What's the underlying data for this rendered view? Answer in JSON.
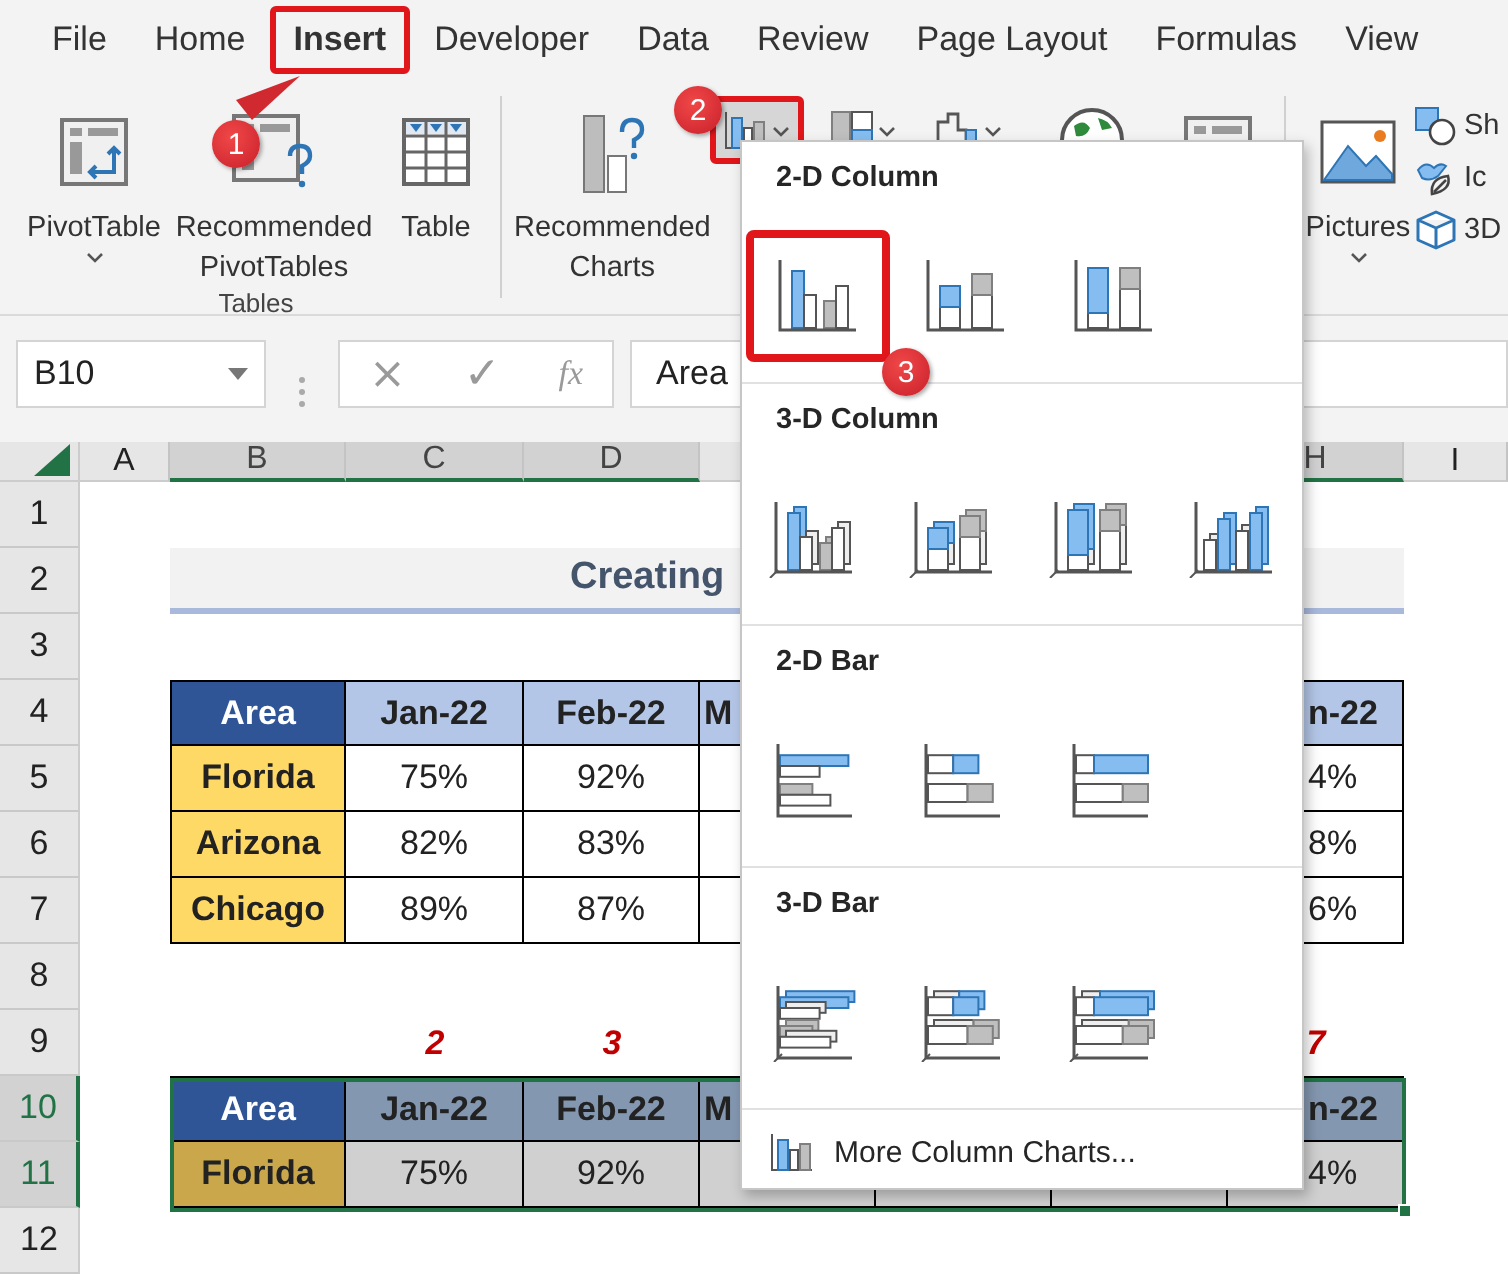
{
  "menu_tabs": [
    {
      "label": "File",
      "selected": false
    },
    {
      "label": "Home",
      "selected": false
    },
    {
      "label": "Insert",
      "selected": true
    },
    {
      "label": "Developer",
      "selected": false
    },
    {
      "label": "Data",
      "selected": false
    },
    {
      "label": "Review",
      "selected": false
    },
    {
      "label": "Page Layout",
      "selected": false
    },
    {
      "label": "Formulas",
      "selected": false
    },
    {
      "label": "View",
      "selected": false
    }
  ],
  "ribbon": {
    "groups": [
      {
        "label": "Tables",
        "buttons": [
          {
            "kind": "pivot-table",
            "label": "PivotTable",
            "dropdown": true
          },
          {
            "kind": "recommended-pivot",
            "label": "Recommended PivotTables"
          },
          {
            "kind": "table",
            "label": "Table"
          }
        ]
      },
      {
        "buttons": [
          {
            "kind": "recommended-charts",
            "label": "Recommended Charts"
          },
          {
            "kind": "column-chart",
            "selected": true
          },
          {
            "kind": "hierarchy-chart",
            "selected": false
          },
          {
            "kind": "waterfall-chart",
            "selected": false
          },
          {
            "kind": "map-chart",
            "selected": false
          },
          {
            "kind": "pivot-chart",
            "selected": false
          }
        ]
      },
      {
        "buttons": [
          {
            "kind": "pictures",
            "label": "Pictures",
            "dropdown": true
          },
          {
            "kind": "shapes",
            "label": "Sh"
          },
          {
            "kind": "icons",
            "label": "Ic"
          },
          {
            "kind": "models",
            "label": "3D"
          }
        ]
      }
    ]
  },
  "formula_bar": {
    "name_box": "B10",
    "buttons": [
      "×",
      "✓",
      "fx"
    ],
    "value": "Area"
  },
  "columns": [
    {
      "letter": "A",
      "selected": false
    },
    {
      "letter": "B",
      "selected": true
    },
    {
      "letter": "C",
      "selected": true
    },
    {
      "letter": "D",
      "selected": true
    },
    {
      "letter": "H",
      "selected": true
    },
    {
      "letter": "I",
      "selected": false
    }
  ],
  "rows": [
    {
      "label": "1",
      "selected": false
    },
    {
      "label": "2",
      "selected": false
    },
    {
      "label": "3",
      "selected": false
    },
    {
      "label": "4",
      "selected": false
    },
    {
      "label": "5",
      "selected": false
    },
    {
      "label": "6",
      "selected": false
    },
    {
      "label": "7",
      "selected": false
    },
    {
      "label": "8",
      "selected": false
    },
    {
      "label": "9",
      "selected": false
    },
    {
      "label": "10",
      "selected": true
    },
    {
      "label": "11",
      "selected": true
    },
    {
      "label": "12",
      "selected": false
    }
  ],
  "title": "Creating",
  "table": {
    "header": [
      "Area",
      "Jan-22",
      "Feb-22",
      "M",
      "n-22"
    ],
    "rows": [
      [
        "Florida",
        "75%",
        "92%",
        "4%"
      ],
      [
        "Arizona",
        "82%",
        "83%",
        "8%"
      ],
      [
        "Chicago",
        "89%",
        "87%",
        "6%"
      ]
    ]
  },
  "step_numbers": [
    "2",
    "3",
    "7"
  ],
  "selected_table": {
    "header": [
      "Area",
      "Jan-22",
      "Feb-22",
      "M",
      "n-22"
    ],
    "rows": [
      [
        "Florida",
        "75%",
        "92%",
        "4%"
      ]
    ]
  },
  "chart_menu": {
    "sections": [
      {
        "title": "2-D Column",
        "items": [
          {
            "kind": "clustered",
            "selected": true
          },
          {
            "kind": "stacked",
            "selected": false
          },
          {
            "kind": "percent",
            "selected": false
          }
        ]
      },
      {
        "title": "3-D Column",
        "items": [
          {
            "kind": "clustered3d",
            "selected": false
          },
          {
            "kind": "stacked3d",
            "selected": false
          },
          {
            "kind": "percent3d",
            "selected": false
          },
          {
            "kind": "deep3d",
            "selected": false
          }
        ]
      },
      {
        "title": "2-D Bar",
        "items": [
          {
            "kind": "clusteredbar",
            "selected": false
          },
          {
            "kind": "stackedbar",
            "selected": false
          },
          {
            "kind": "percentbar",
            "selected": false
          }
        ]
      },
      {
        "title": "3-D Bar",
        "items": [
          {
            "kind": "clustered3dbar",
            "selected": false
          },
          {
            "kind": "stacked3dbar",
            "selected": false
          },
          {
            "kind": "percent3dbar",
            "selected": false
          }
        ]
      }
    ],
    "footer": "More Column Charts..."
  },
  "callouts": [
    "1",
    "2",
    "3"
  ]
}
